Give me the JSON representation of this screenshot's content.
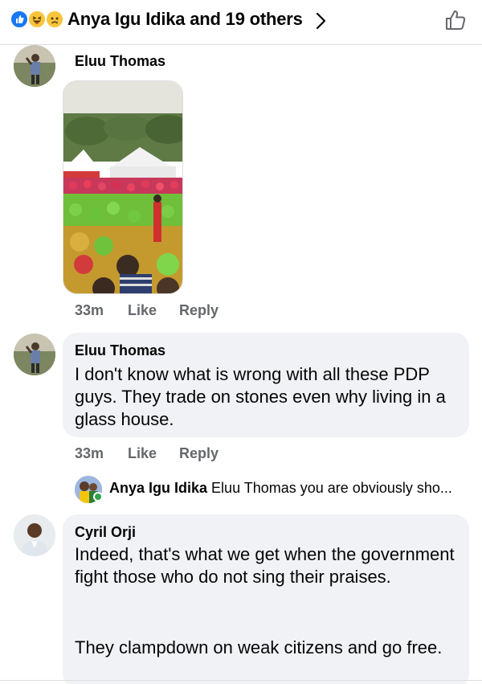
{
  "header": {
    "title": "Anya Igu Idika and 19 others",
    "reactions": [
      "like-reaction-icon",
      "haha-reaction-icon",
      "sad-reaction-icon"
    ],
    "like_icon": "thumbs-up-outline-icon",
    "accent_color": "#1877f2"
  },
  "comments": [
    {
      "author": "Eluu Thomas",
      "attachment": "photo",
      "time": "33m",
      "like_label": "Like",
      "reply_label": "Reply"
    },
    {
      "author": "Eluu Thomas",
      "text": "I don't know what is wrong with all these PDP guys. They trade on stones even why living in a glass house.",
      "time": "33m",
      "like_label": "Like",
      "reply_label": "Reply",
      "reply_preview": {
        "author": "Anya Igu Idika",
        "text": "Eluu Thomas you are obviously sho..."
      }
    },
    {
      "author": "Cyril Orji",
      "text_p1": "Indeed, that's what we get when the government fight those who do not sing their praises.",
      "text_p2": "They clampdown on weak citizens and go free."
    }
  ],
  "colors": {
    "bubble": "#f0f2f5",
    "meta": "#65676b",
    "online": "#31a24c"
  }
}
